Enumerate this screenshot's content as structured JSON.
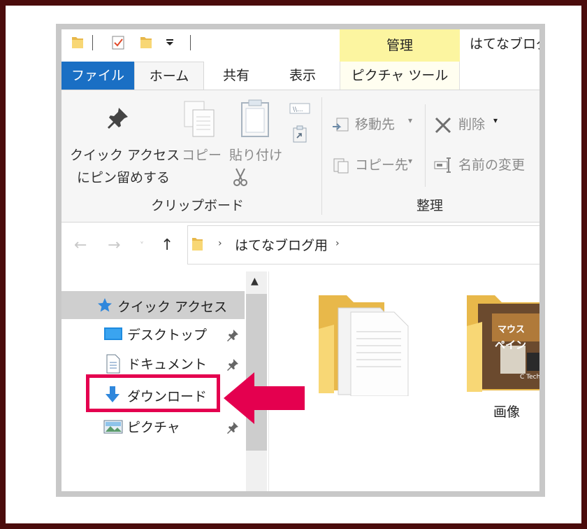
{
  "title_bar": {
    "manage_tab": "管理",
    "window_title": "はてなブログ"
  },
  "tabs": {
    "file": "ファイル",
    "home": "ホーム",
    "share": "共有",
    "view": "表示",
    "picture_tools": "ピクチャ ツール"
  },
  "ribbon": {
    "pin_quick_access_line1": "クイック アクセス",
    "pin_quick_access_line2": "にピン留めする",
    "copy": "コピー",
    "paste": "貼り付け",
    "clipboard_group": "クリップボード",
    "move_to": "移動先",
    "copy_to": "コピー先",
    "delete": "削除",
    "rename": "名前の変更",
    "organize_group": "整理"
  },
  "address": {
    "folder": "はてなブログ用"
  },
  "nav": {
    "quick_access": "クイック アクセス",
    "items": [
      {
        "label": "デスクトップ"
      },
      {
        "label": "ドキュメント"
      },
      {
        "label": "ダウンロード"
      },
      {
        "label": "ピクチャ"
      }
    ]
  },
  "content": {
    "folders": [
      {
        "label": ""
      },
      {
        "label": "画像"
      }
    ],
    "thumbnail_text": [
      "マウス",
      "ペイン",
      "C Tech"
    ]
  },
  "colors": {
    "frame": "#4b0c0c",
    "file_tab": "#1a6fc4",
    "manage_tab": "#fcf5a0",
    "highlight": "#e4004f",
    "folder": "#f8d775"
  }
}
